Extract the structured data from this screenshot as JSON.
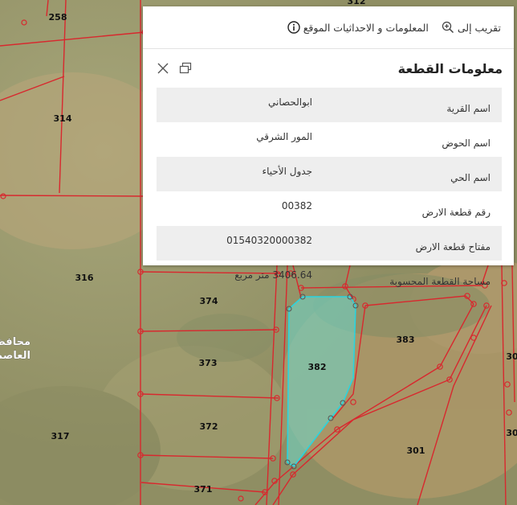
{
  "map": {
    "parcel_labels": [
      {
        "id": "258",
        "text": "258"
      },
      {
        "id": "314",
        "text": "314"
      },
      {
        "id": "316",
        "text": "316"
      },
      {
        "id": "317",
        "text": "317"
      },
      {
        "id": "374",
        "text": "374"
      },
      {
        "id": "373",
        "text": "373"
      },
      {
        "id": "372",
        "text": "372"
      },
      {
        "id": "371",
        "text": "371"
      },
      {
        "id": "382",
        "text": "382"
      },
      {
        "id": "383",
        "text": "383"
      },
      {
        "id": "301",
        "text": "301"
      },
      {
        "id": "312",
        "text": "312"
      },
      {
        "id": "30a",
        "text": "30"
      },
      {
        "id": "30b",
        "text": "30"
      }
    ],
    "governorate_label_line1": "محافظ",
    "governorate_label_line2": "العاصم",
    "colors": {
      "parcel_boundary": "#d8282e",
      "selected_fill": "#6fd3c4",
      "selected_stroke": "#29d5e0"
    }
  },
  "popup": {
    "toolbar": {
      "zoom_to": "تقريب إلى",
      "zoom_icon": "zoom-in-icon",
      "site_info": "المعلومات و الاحداثيات الموقع",
      "info_icon": "info-icon"
    },
    "title": "معلومات القطعة",
    "restore_icon": "restore-window-icon",
    "close_icon": "close-icon",
    "rows": [
      {
        "key": "اسم القرية",
        "value": "ابوالحصاني"
      },
      {
        "key": "اسم الحوض",
        "value": "المور الشرقي"
      },
      {
        "key": "اسم الحي",
        "value": "جدول الأحياء"
      },
      {
        "key": "رقم قطعة الارض",
        "value": "00382"
      },
      {
        "key": "مفتاح قطعة الارض",
        "value": "01540320000382"
      },
      {
        "key": "مساحة القطعة المحسوبة",
        "value": "3406.64 متر مربع"
      }
    ]
  }
}
